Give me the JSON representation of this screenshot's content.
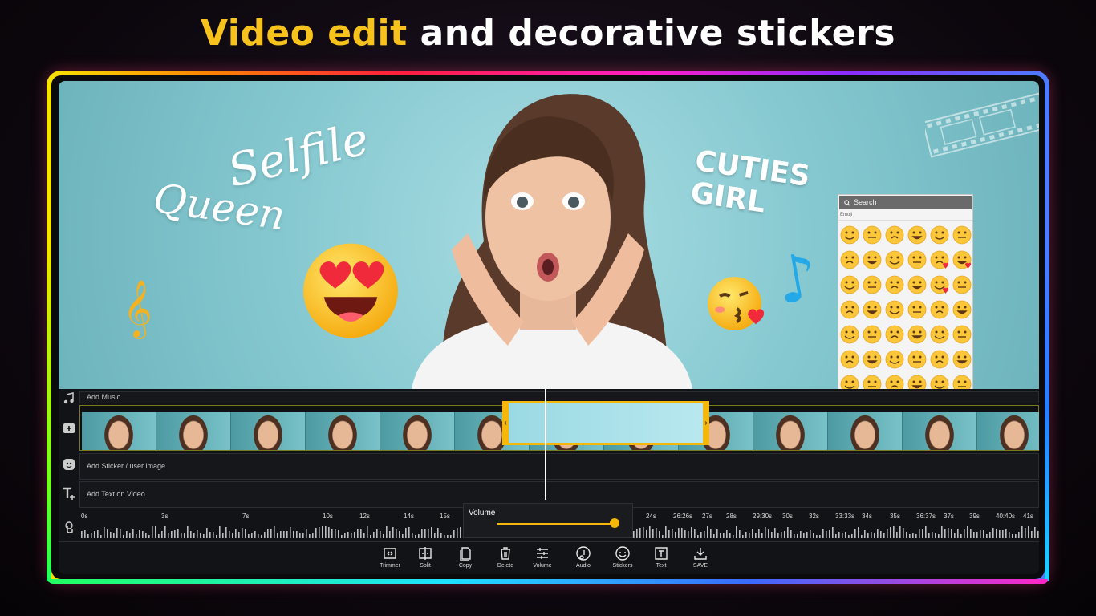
{
  "headline": {
    "part1": "Video edit",
    "part2": "and decorative stickers"
  },
  "colors": {
    "accent": "#f5b80a",
    "background": "#121316",
    "preview_bg": "#84c7cf"
  },
  "preview": {
    "sticker_script_1": "Selfile",
    "sticker_script_2": "Queen",
    "sticker_bold_1": "CUTIES",
    "sticker_bold_2": "GIRL"
  },
  "emoji_picker": {
    "search_placeholder": "Search",
    "category": "Emoji",
    "icons": [
      "grinning-face",
      "grinning-big-eyes",
      "beaming-face",
      "grinning-squinting",
      "grinning-sweat",
      "rolling-laughing",
      "slightly-smiling",
      "winking",
      "smiling-eyes",
      "relieved",
      "smiling-hearts",
      "heart-eyes",
      "star-struck",
      "smiling",
      "smiling-blush",
      "tongue-out",
      "kissing-heart",
      "kissing",
      "yum",
      "zany",
      "tongue-winking",
      "squinting-tongue",
      "smirking",
      "laughing",
      "neutral",
      "expressionless",
      "unamused",
      "rolling-eyes",
      "grimacing",
      "frowning",
      "pensive",
      "worried",
      "sleeping",
      "confused",
      "slightly-frowning",
      "astonished",
      "anxious",
      "flushed",
      "hushed",
      "sad",
      "disappointed",
      "fearful"
    ]
  },
  "timeline": {
    "add_music": "Add Music",
    "add_sticker": "Add Sticker / user image",
    "add_text": "Add Text on Video",
    "ticks": [
      "0s",
      "3s",
      "7s",
      "10s",
      "12s",
      "14s",
      "15s",
      "24s",
      "26:26s",
      "27s",
      "28s",
      "29:30s",
      "30s",
      "32s",
      "33:33s",
      "34s",
      "35s",
      "36:37s",
      "37s",
      "39s",
      "40:40s",
      "41s"
    ],
    "volume_label": "Volume",
    "volume_level": 0.97
  },
  "toolbar": {
    "items": [
      {
        "label": "Trimmer",
        "icon": "trimmer-icon"
      },
      {
        "label": "Split",
        "icon": "split-icon"
      },
      {
        "label": "Copy",
        "icon": "copy-icon"
      },
      {
        "label": "Delete",
        "icon": "delete-icon"
      },
      {
        "label": "Volume",
        "icon": "volume-icon"
      },
      {
        "label": "Audio",
        "icon": "audio-icon"
      },
      {
        "label": "Stickers",
        "icon": "stickers-icon"
      },
      {
        "label": "Text",
        "icon": "text-icon"
      },
      {
        "label": "SAVE",
        "icon": "save-icon"
      }
    ]
  }
}
